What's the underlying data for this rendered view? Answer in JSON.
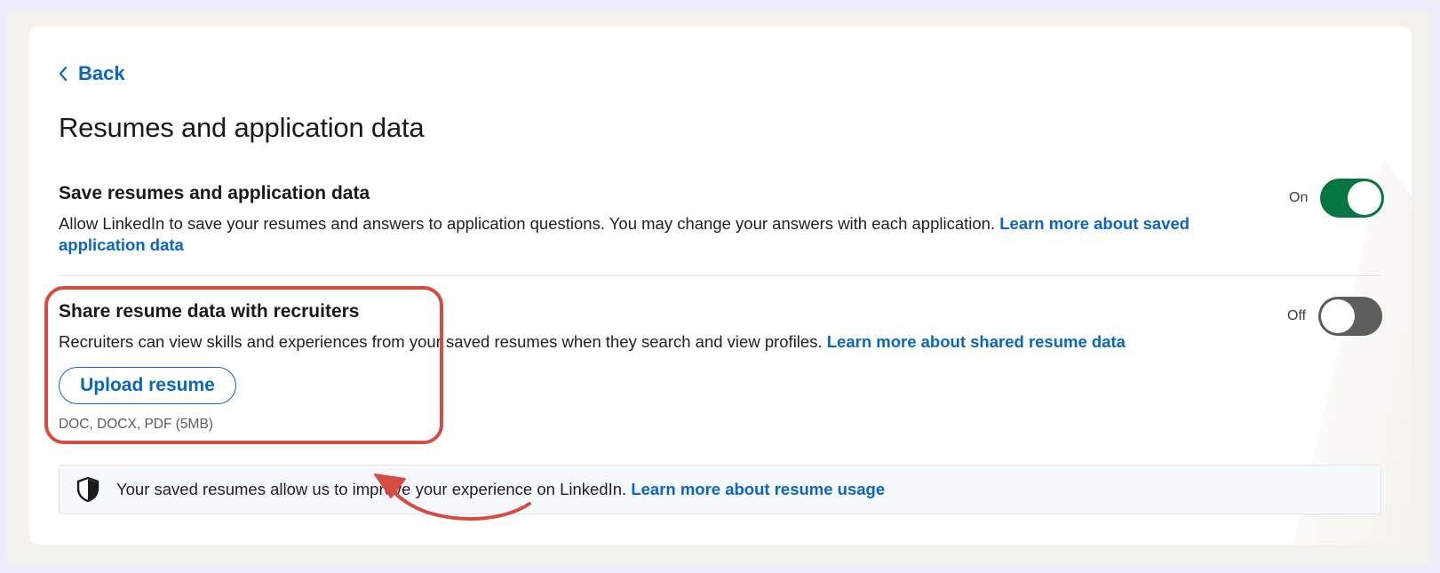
{
  "back": {
    "label": "Back",
    "icon": "chevron-left-icon"
  },
  "page": {
    "title": "Resumes and application data"
  },
  "save_setting": {
    "title": "Save resumes and application data",
    "description": "Allow LinkedIn to save your resumes and answers to application questions. You may change your answers with each application.",
    "link": "Learn more about saved application data",
    "toggle_state": "On",
    "enabled": true
  },
  "share_setting": {
    "title": "Share resume data with recruiters",
    "description": "Recruiters can view skills and experiences from your saved resumes when they search and view profiles.",
    "link": "Learn more about shared resume data",
    "toggle_state": "Off",
    "enabled": false,
    "upload_label": "Upload resume",
    "formats": "DOC, DOCX, PDF (5MB)"
  },
  "notice": {
    "icon": "shield-icon",
    "text": "Your saved resumes allow us to improve your experience on LinkedIn.",
    "link": "Learn more about resume usage"
  },
  "colors": {
    "link": "#0a66c2",
    "toggle_on": "#057642",
    "toggle_off": "#5e5e5e",
    "annotation": "#d64b42"
  }
}
